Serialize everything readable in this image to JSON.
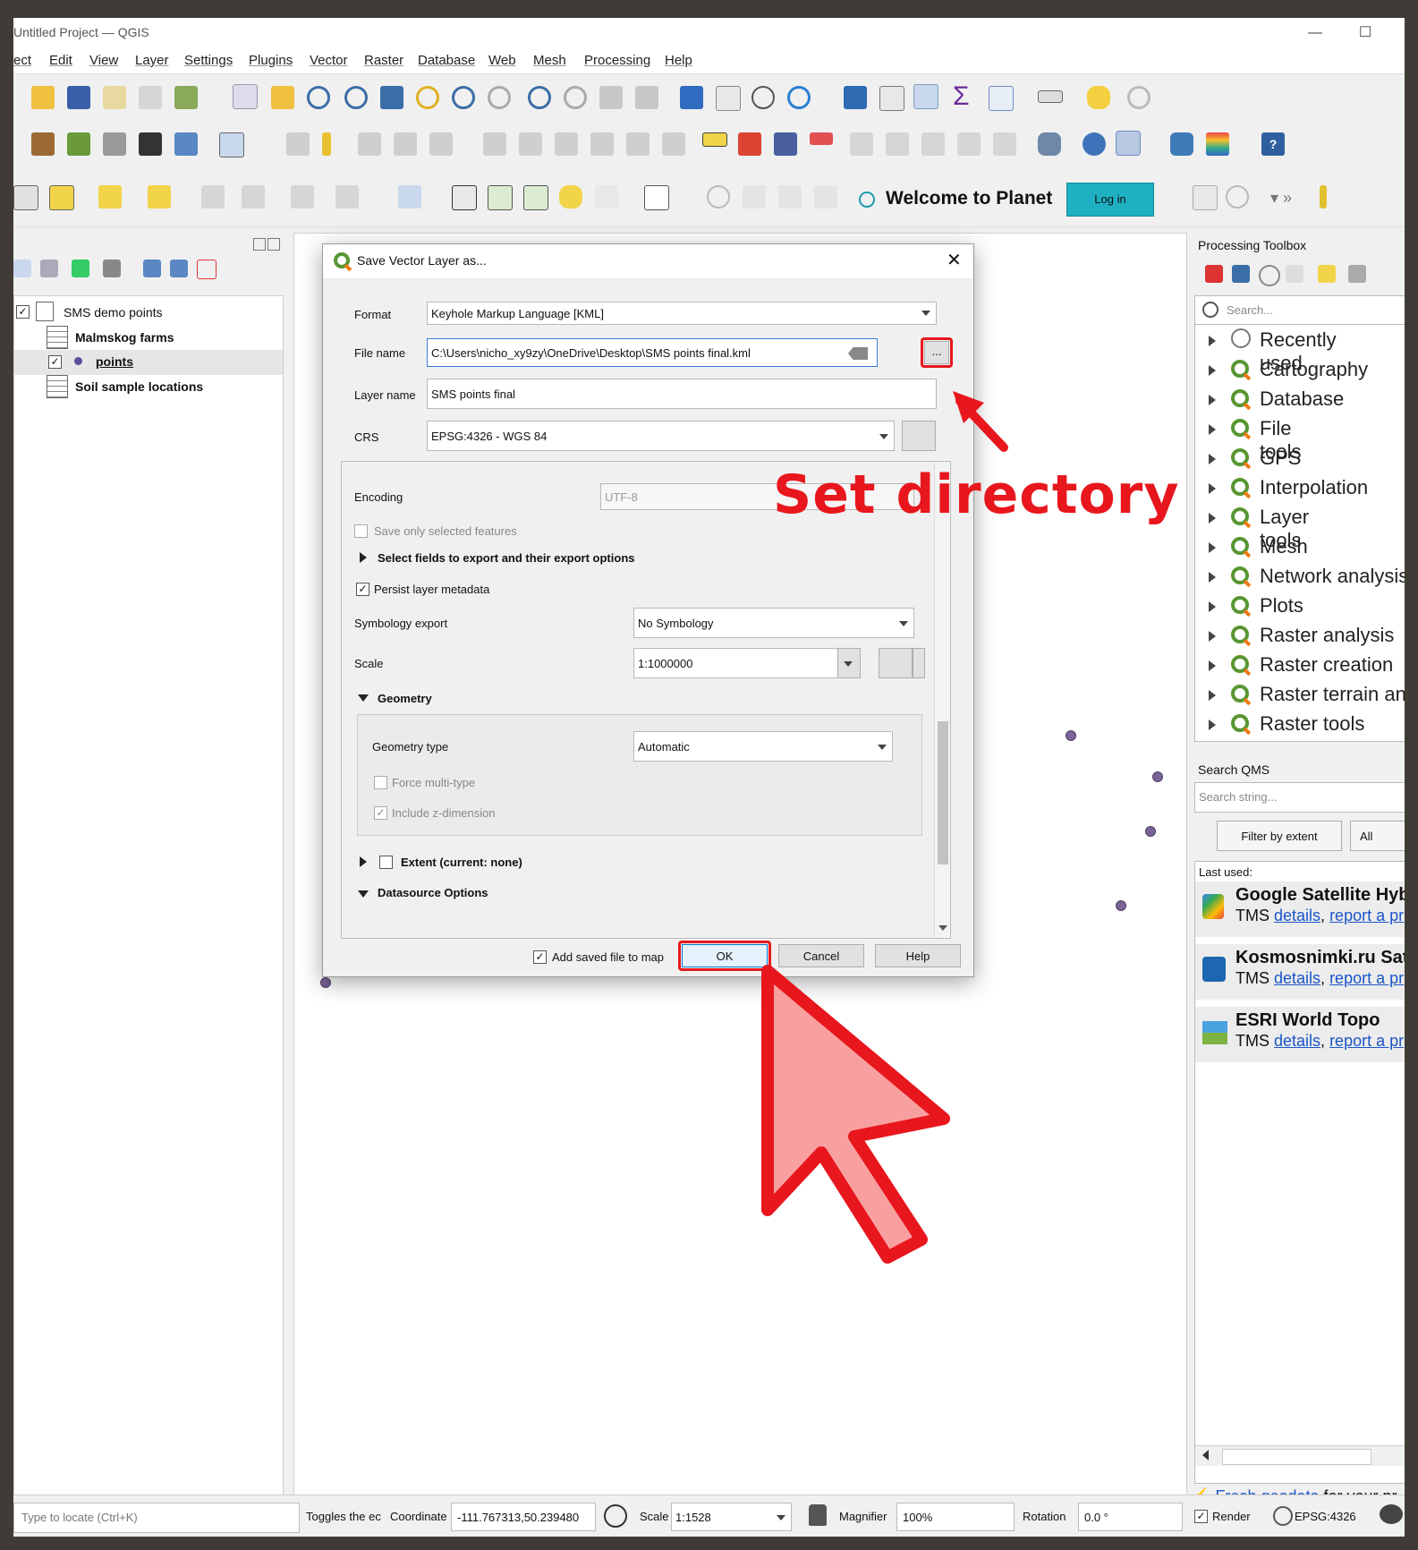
{
  "window": {
    "title": "Untitled Project — QGIS"
  },
  "menu": [
    "ect",
    "Edit",
    "View",
    "Layer",
    "Settings",
    "Plugins",
    "Vector",
    "Raster",
    "Database",
    "Web",
    "Mesh",
    "Processing",
    "Help"
  ],
  "planet": {
    "welcome": "Welcome to Planet",
    "login": "Log in"
  },
  "layers": {
    "group": "SMS demo points",
    "items": [
      "Malmskog farms",
      "points",
      "Soil sample locations"
    ]
  },
  "dialog": {
    "title": "Save Vector Layer as...",
    "format_label": "Format",
    "format_value": "Keyhole Markup Language [KML]",
    "filename_label": "File name",
    "filename_value": "C:\\Users\\nicho_xy9zy\\OneDrive\\Desktop\\SMS points final.kml",
    "browse": "...",
    "layername_label": "Layer name",
    "layername_value": "SMS points final",
    "crs_label": "CRS",
    "crs_value": "EPSG:4326 - WGS 84",
    "encoding_label": "Encoding",
    "encoding_value": "UTF-8",
    "save_selected": "Save only selected features",
    "select_fields": "Select fields to export and their export options",
    "persist_metadata": "Persist layer metadata",
    "symbology_label": "Symbology export",
    "symbology_value": "No Symbology",
    "scale_label": "Scale",
    "scale_value": "1:1000000",
    "geometry_header": "Geometry",
    "geometry_type_label": "Geometry type",
    "geometry_type_value": "Automatic",
    "force_multi": "Force multi-type",
    "include_z": "Include z-dimension",
    "extent": "Extent (current: none)",
    "datasource": "Datasource Options",
    "add_to_map": "Add saved file to map",
    "ok": "OK",
    "cancel": "Cancel",
    "help": "Help"
  },
  "toolbox": {
    "title": "Processing Toolbox",
    "search_placeholder": "Search...",
    "items": [
      "Recently used",
      "Cartography",
      "Database",
      "File tools",
      "GPS",
      "Interpolation",
      "Layer tools",
      "Mesh",
      "Network analysis",
      "Plots",
      "Raster analysis",
      "Raster creation",
      "Raster terrain an...",
      "Raster tools"
    ]
  },
  "qms": {
    "title": "Search QMS",
    "search_placeholder": "Search string...",
    "filter_btn": "Filter by extent",
    "filter_all": "All",
    "last_used": "Last used:",
    "entries": [
      {
        "name": "Google Satellite Hyb",
        "type": "TMS",
        "details": "details",
        "report": "report a pr"
      },
      {
        "name": "Kosmosnimki.ru Sate",
        "type": "TMS",
        "details": "details",
        "report": "report a pr"
      },
      {
        "name": "ESRI World Topo",
        "type": "TMS",
        "details": "details",
        "report": "report a pr"
      }
    ],
    "fresh_link": "Fresh geodata",
    "fresh_text": " for your pr"
  },
  "status": {
    "locate_placeholder": "Type to locate (Ctrl+K)",
    "toggles": "Toggles the ec",
    "coordinate_label": "Coordinate",
    "coordinate_value": "-111.767313,50.239480",
    "scale_label": "Scale",
    "scale_value": "1:1528",
    "magnifier_label": "Magnifier",
    "magnifier_value": "100%",
    "rotation_label": "Rotation",
    "rotation_value": "0.0 °",
    "render_label": "Render",
    "epsg": "EPSG:4326"
  },
  "annotation": {
    "text": "Set directory",
    "color": "#e8161d"
  }
}
